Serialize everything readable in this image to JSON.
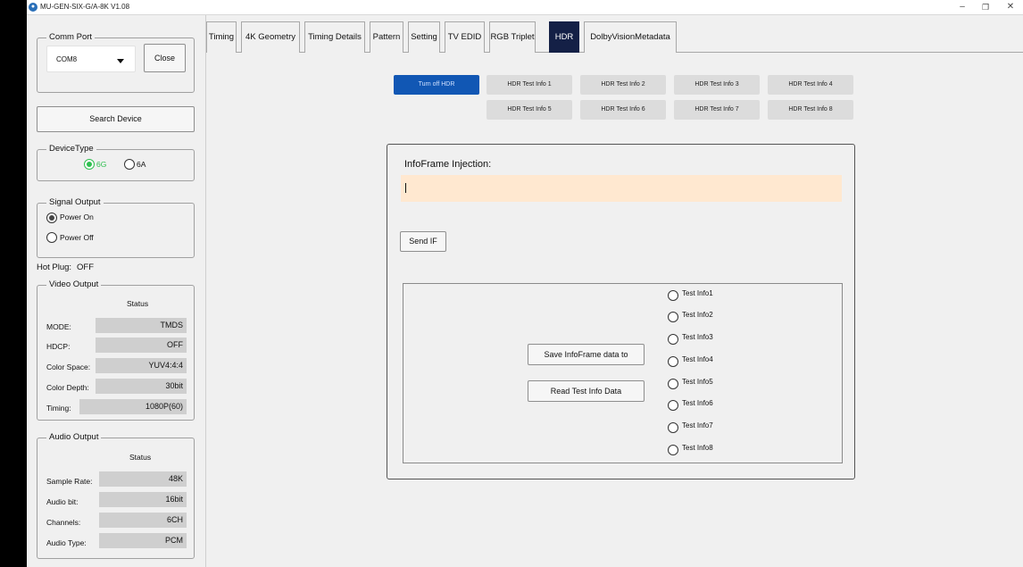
{
  "window": {
    "title": "MU-GEN-SIX-G/A-8K V1.08",
    "minimize": "–",
    "restore": "❐",
    "close": "✕"
  },
  "comm_port": {
    "legend": "Comm Port",
    "selected": "COM8",
    "close_label": "Close"
  },
  "search_device_label": "Search Device",
  "device_type": {
    "legend": "DeviceType",
    "options": [
      "6G",
      "6A"
    ],
    "selected": "6G"
  },
  "signal_output": {
    "legend": "Signal Output",
    "options": [
      "Power On",
      "Power Off"
    ],
    "selected": "Power On"
  },
  "hot_plug": {
    "label": "Hot Plug:",
    "value": "OFF"
  },
  "video_output": {
    "legend": "Video Output",
    "status_header": "Status",
    "rows": [
      {
        "label": "MODE:",
        "value": "TMDS"
      },
      {
        "label": "HDCP:",
        "value": "OFF"
      },
      {
        "label": "Color Space:",
        "value": "YUV4:4:4"
      },
      {
        "label": "Color Depth:",
        "value": "30bit"
      },
      {
        "label": "Timing:",
        "value": "1080P(60)"
      }
    ]
  },
  "audio_output": {
    "legend": "Audio Output",
    "status_header": "Status",
    "rows": [
      {
        "label": "Sample Rate:",
        "value": "48K"
      },
      {
        "label": "Audio bit:",
        "value": "16bit"
      },
      {
        "label": "Channels:",
        "value": "6CH"
      },
      {
        "label": "Audio Type:",
        "value": "PCM"
      }
    ]
  },
  "tabs": [
    "Timing",
    "4K Geometry",
    "Timing Details",
    "Pattern",
    "Setting",
    "TV EDID",
    "RGB Triplet",
    "HDR",
    "DolbyVisionMetadata"
  ],
  "active_tab": "HDR",
  "hdr": {
    "turn_off_label": "Turn off HDR",
    "test_info_buttons": [
      "HDR Test Info 1",
      "HDR Test Info 2",
      "HDR Test Info 3",
      "HDR Test Info 4",
      "HDR Test Info 5",
      "HDR Test Info 6",
      "HDR Test Info 7",
      "HDR Test Info 8"
    ],
    "injection_title": "InfoFrame Injection:",
    "injection_value": "",
    "send_if_label": "Send IF",
    "save_label": "Save InfoFrame data to",
    "read_label": "Read Test Info Data",
    "test_info_radios": [
      "Test Info1",
      "Test Info2",
      "Test Info3",
      "Test Info4",
      "Test Info5",
      "Test Info6",
      "Test Info7",
      "Test Info8"
    ]
  },
  "colors": {
    "active_tab": "#142046",
    "primary_button": "#1157b4",
    "injection_field": "#ffe8d0",
    "selected_device_radio": "#2ebf4f"
  }
}
